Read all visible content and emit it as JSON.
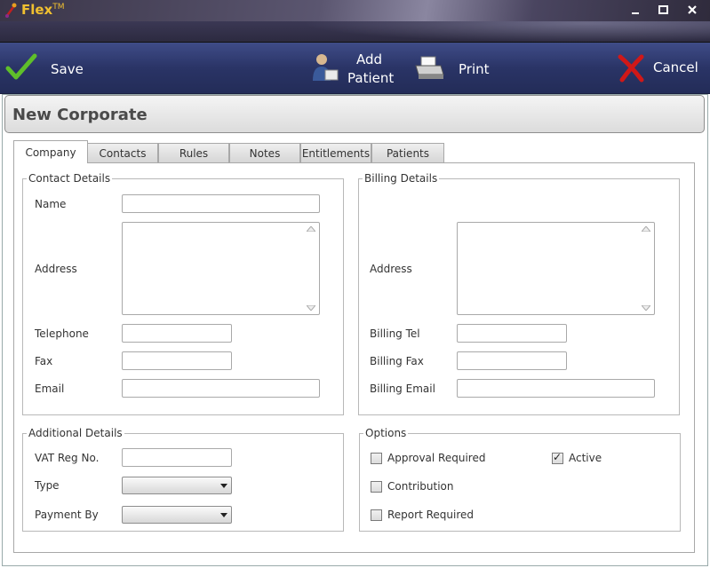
{
  "window": {
    "title": "Flex",
    "title_mark": "TM",
    "minimize": "▂",
    "maximize": "■",
    "close": "✕"
  },
  "toolbar": {
    "save_label": "Save",
    "add_patient_line1": "Add",
    "add_patient_line2": "Patient",
    "print_label": "Print",
    "cancel_label": "Cancel"
  },
  "header": {
    "title": "New Corporate"
  },
  "tabs": [
    {
      "label": "Company"
    },
    {
      "label": "Contacts"
    },
    {
      "label": "Rules"
    },
    {
      "label": "Notes"
    },
    {
      "label": "Entitlements"
    },
    {
      "label": "Patients"
    }
  ],
  "contact_details": {
    "legend": "Contact Details",
    "name_label": "Name",
    "name_value": "",
    "address_label": "Address",
    "address_value": "",
    "telephone_label": "Telephone",
    "telephone_value": "",
    "fax_label": "Fax",
    "fax_value": "",
    "email_label": "Email",
    "email_value": ""
  },
  "billing_details": {
    "legend": "Billing Details",
    "address_label": "Address",
    "address_value": "",
    "tel_label": "Billing Tel",
    "tel_value": "",
    "fax_label": "Billing Fax",
    "fax_value": "",
    "email_label": "Billing Email",
    "email_value": ""
  },
  "additional_details": {
    "legend": "Additional Details",
    "vat_label": "VAT Reg No.",
    "vat_value": "",
    "type_label": "Type",
    "type_value": "",
    "payment_label": "Payment By",
    "payment_value": ""
  },
  "options": {
    "legend": "Options",
    "approval_label": "Approval Required",
    "approval_checked": false,
    "active_label": "Active",
    "active_checked": true,
    "contribution_label": "Contribution",
    "contribution_checked": false,
    "report_label": "Report Required",
    "report_checked": false
  },
  "colors": {
    "title_accent": "#f0c030",
    "toolbar": "#2a3466",
    "save_check": "#5fbf2a",
    "cancel_x": "#d01818"
  }
}
